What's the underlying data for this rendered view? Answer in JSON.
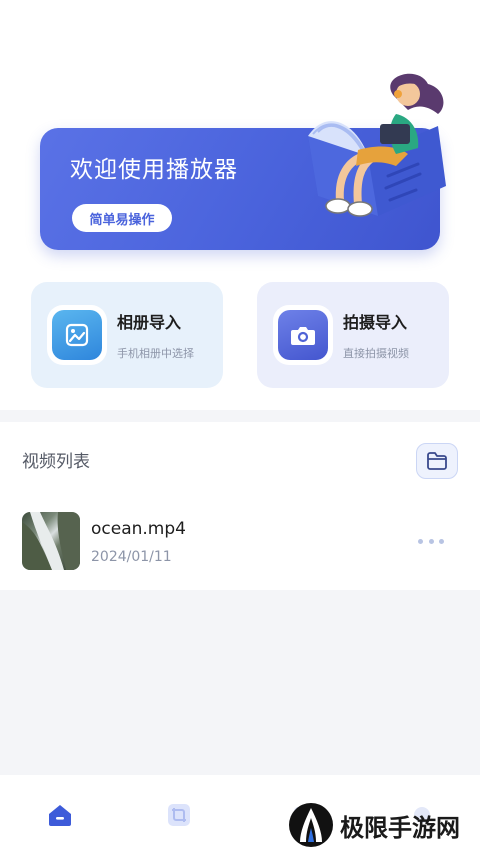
{
  "banner": {
    "title": "欢迎使用播放器",
    "button_label": "简单易操作"
  },
  "import_cards": [
    {
      "title": "相册导入",
      "subtitle": "手机相册中选择",
      "icon": "image-icon"
    },
    {
      "title": "拍摄导入",
      "subtitle": "直接拍摄视频",
      "icon": "camera-icon"
    }
  ],
  "video_list": {
    "title": "视频列表",
    "folder_icon": "folder-icon",
    "items": [
      {
        "name": "ocean.mp4",
        "date": "2024/01/11"
      }
    ]
  },
  "bottom_nav": {
    "items": [
      {
        "icon": "home-icon",
        "active": true
      },
      {
        "icon": "crop-icon",
        "active": false
      },
      {
        "icon": "nav-icon-3",
        "active": false
      },
      {
        "icon": "nav-icon-4",
        "active": false
      }
    ]
  },
  "watermark": {
    "text": "极限手游网"
  },
  "colors": {
    "primary": "#4a63dc",
    "album_card": "#e7f1fb",
    "camera_card": "#ebeefb",
    "muted_text": "#8d95a8"
  }
}
